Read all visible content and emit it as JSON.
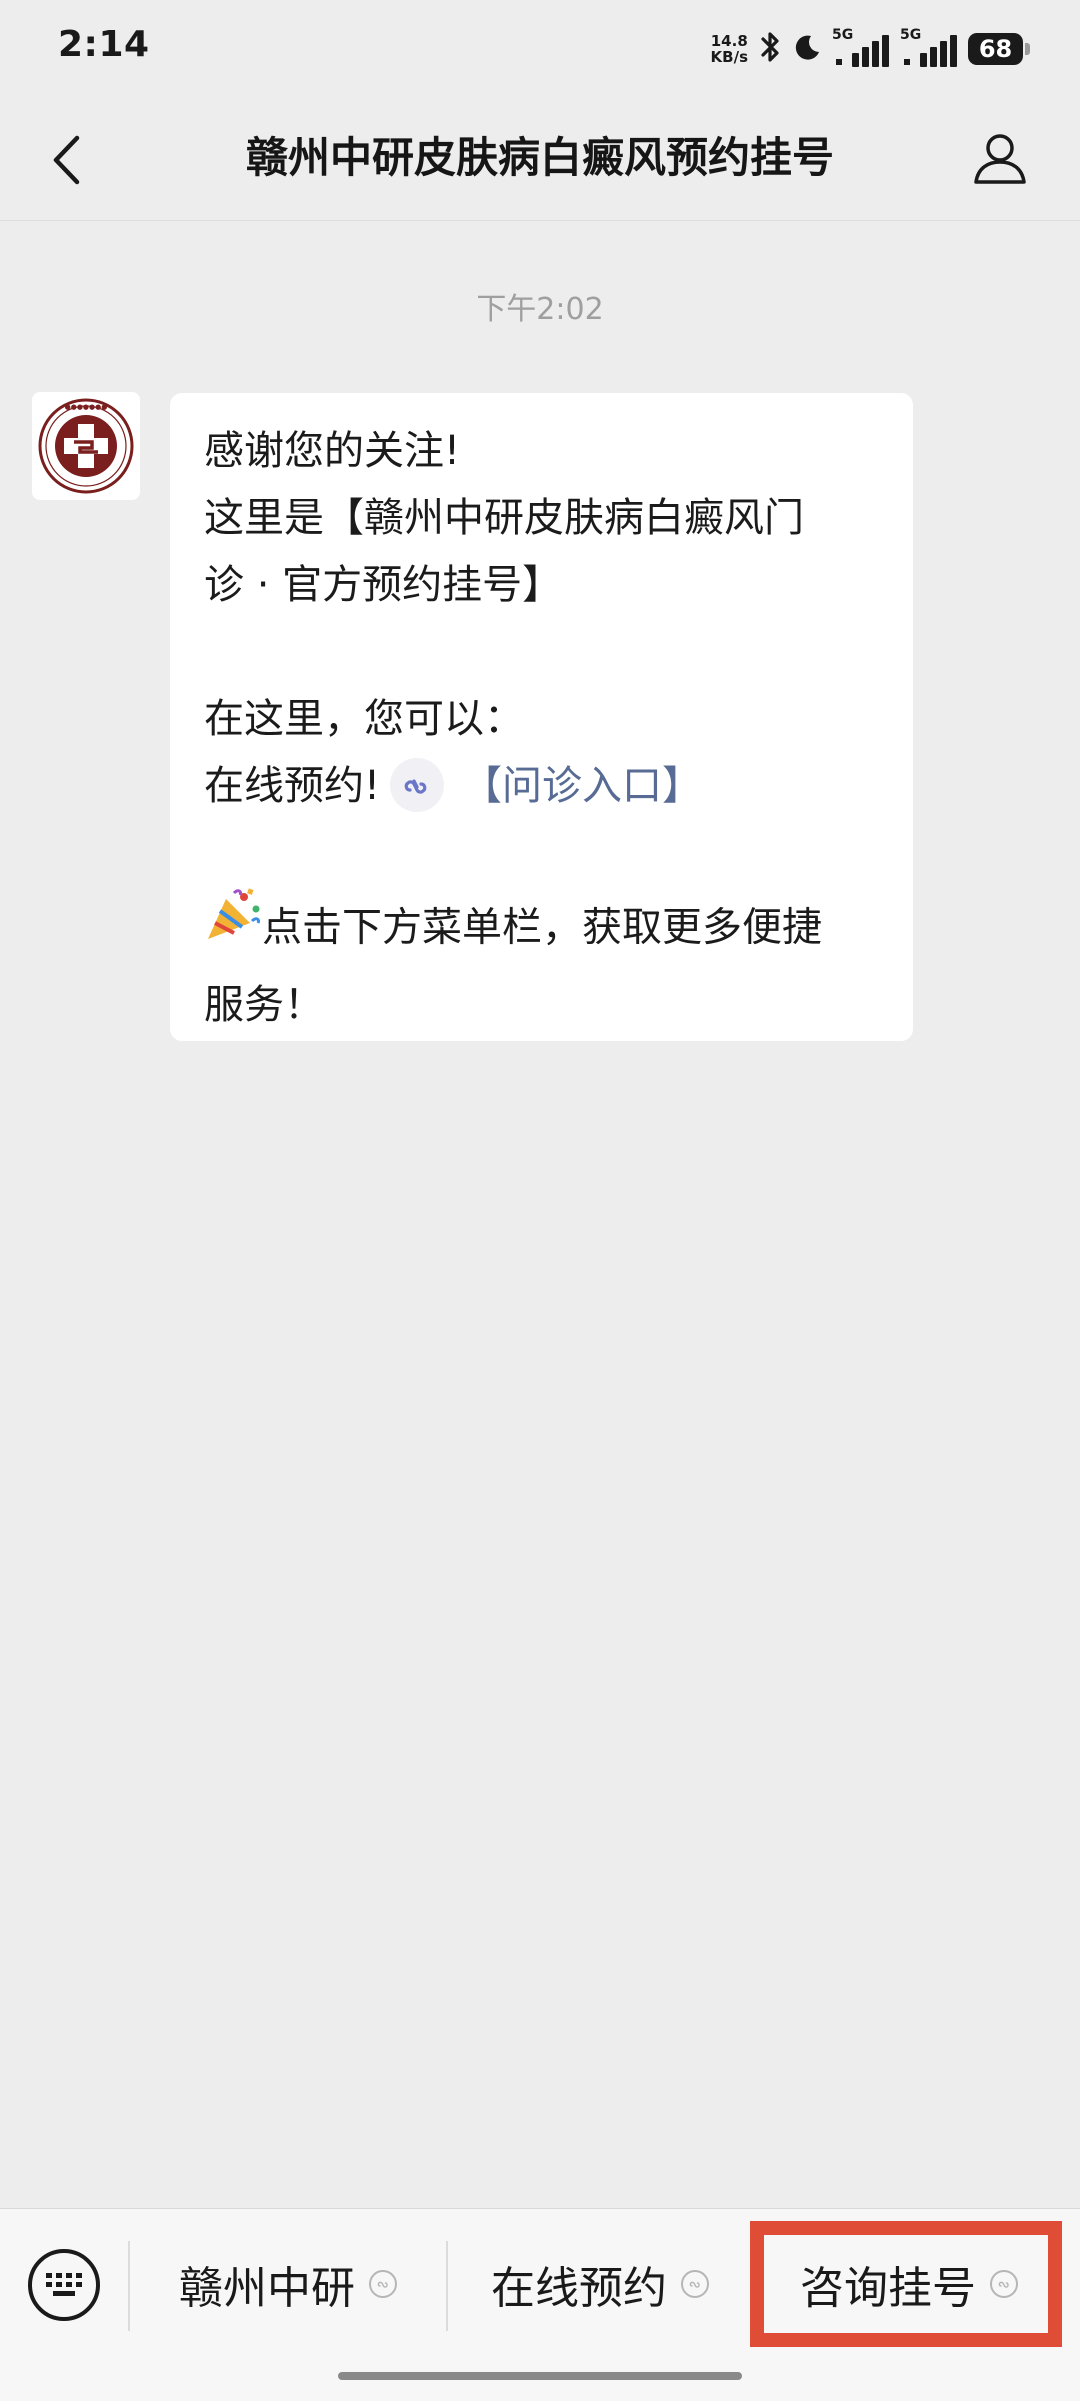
{
  "status_bar": {
    "time": "2:14",
    "net_speed_value": "14.8",
    "net_speed_unit": "KB/s",
    "sim1": "5G",
    "sim2": "5G",
    "battery": "68"
  },
  "header": {
    "title": "赣州中研皮肤病白癜风预约挂号",
    "icons": [
      "back-arrow",
      "profile"
    ]
  },
  "chat": {
    "timestamp": "下午2:02",
    "message": {
      "line1": "感谢您的关注!",
      "line2": "这里是【赣州中研皮肤病白癜风门",
      "line3": "诊 · 官方预约挂号】",
      "line4": "在这里，您可以：",
      "line5_prefix": "在线预约!",
      "line5_link": "【问诊入口】",
      "line6": "点击下方菜单栏，获取更多便捷",
      "line7": "服务！"
    }
  },
  "menu": {
    "items": [
      {
        "label": "赣州中研"
      },
      {
        "label": "在线预约"
      },
      {
        "label": "咨询挂号"
      }
    ]
  },
  "colors": {
    "background": "#ededed",
    "bubble": "#ffffff",
    "link": "#576b95",
    "highlight": "#e04d36"
  }
}
